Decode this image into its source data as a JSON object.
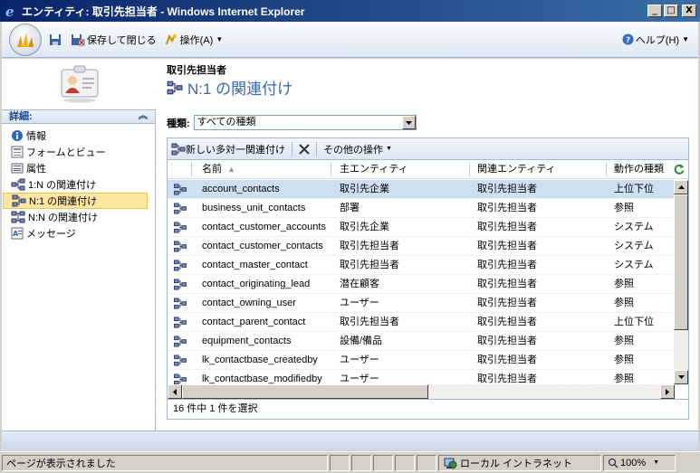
{
  "window": {
    "title": "エンティティ: 取引先担当者 - Windows Internet Explorer",
    "buttons": [
      "_",
      "□",
      "X"
    ]
  },
  "toolbar": {
    "save_close_label": "保存して閉じる",
    "actions_label": "操作(A)",
    "help_label": "ヘルプ(H)"
  },
  "header": {
    "entity_name": "取引先担当者",
    "page_title": "N:1 の関連付け"
  },
  "sidebar": {
    "section_title": "詳細:",
    "items": [
      {
        "label": "情報",
        "icon": "info-icon"
      },
      {
        "label": "フォームとビュー",
        "icon": "form-icon"
      },
      {
        "label": "属性",
        "icon": "attributes-icon"
      },
      {
        "label": "1:N の関連付け",
        "icon": "relationship-1n-icon"
      },
      {
        "label": "N:1 の関連付け",
        "icon": "relationship-n1-icon",
        "selected": true
      },
      {
        "label": "N:N の関連付け",
        "icon": "relationship-nn-icon"
      },
      {
        "label": "メッセージ",
        "icon": "message-icon"
      }
    ]
  },
  "filter": {
    "label": "種類:",
    "value": "すべての種類"
  },
  "grid": {
    "toolbar": {
      "new_label": "新しい多対一関連付け",
      "more_actions_label": "その他の操作"
    },
    "columns": [
      "名前",
      "主エンティティ",
      "関連エンティティ",
      "動作の種類"
    ],
    "rows": [
      {
        "name": "account_contacts",
        "primary": "取引先企業",
        "related": "取引先担当者",
        "behavior": "上位下位",
        "selected": true
      },
      {
        "name": "business_unit_contacts",
        "primary": "部署",
        "related": "取引先担当者",
        "behavior": "参照"
      },
      {
        "name": "contact_customer_accounts",
        "primary": "取引先企業",
        "related": "取引先担当者",
        "behavior": "システム"
      },
      {
        "name": "contact_customer_contacts",
        "primary": "取引先担当者",
        "related": "取引先担当者",
        "behavior": "システム"
      },
      {
        "name": "contact_master_contact",
        "primary": "取引先担当者",
        "related": "取引先担当者",
        "behavior": "システム"
      },
      {
        "name": "contact_originating_lead",
        "primary": "潜在顧客",
        "related": "取引先担当者",
        "behavior": "参照"
      },
      {
        "name": "contact_owning_user",
        "primary": "ユーザー",
        "related": "取引先担当者",
        "behavior": "参照"
      },
      {
        "name": "contact_parent_contact",
        "primary": "取引先担当者",
        "related": "取引先担当者",
        "behavior": "上位下位"
      },
      {
        "name": "equipment_contacts",
        "primary": "設備/備品",
        "related": "取引先担当者",
        "behavior": "参照"
      },
      {
        "name": "lk_contactbase_createdby",
        "primary": "ユーザー",
        "related": "取引先担当者",
        "behavior": "参照"
      },
      {
        "name": "lk_contactbase_modifiedby",
        "primary": "ユーザー",
        "related": "取引先担当者",
        "behavior": "参照"
      }
    ],
    "footer": "16 件中 1 件を選択"
  },
  "statusbar": {
    "text": "ページが表示されました",
    "zone": "ローカル イントラネット",
    "zoom": "100%"
  },
  "colors": {
    "accent": "#3b6aa8",
    "selected_row": "#cfdff2",
    "selected_nav": "#ffe7a2"
  }
}
